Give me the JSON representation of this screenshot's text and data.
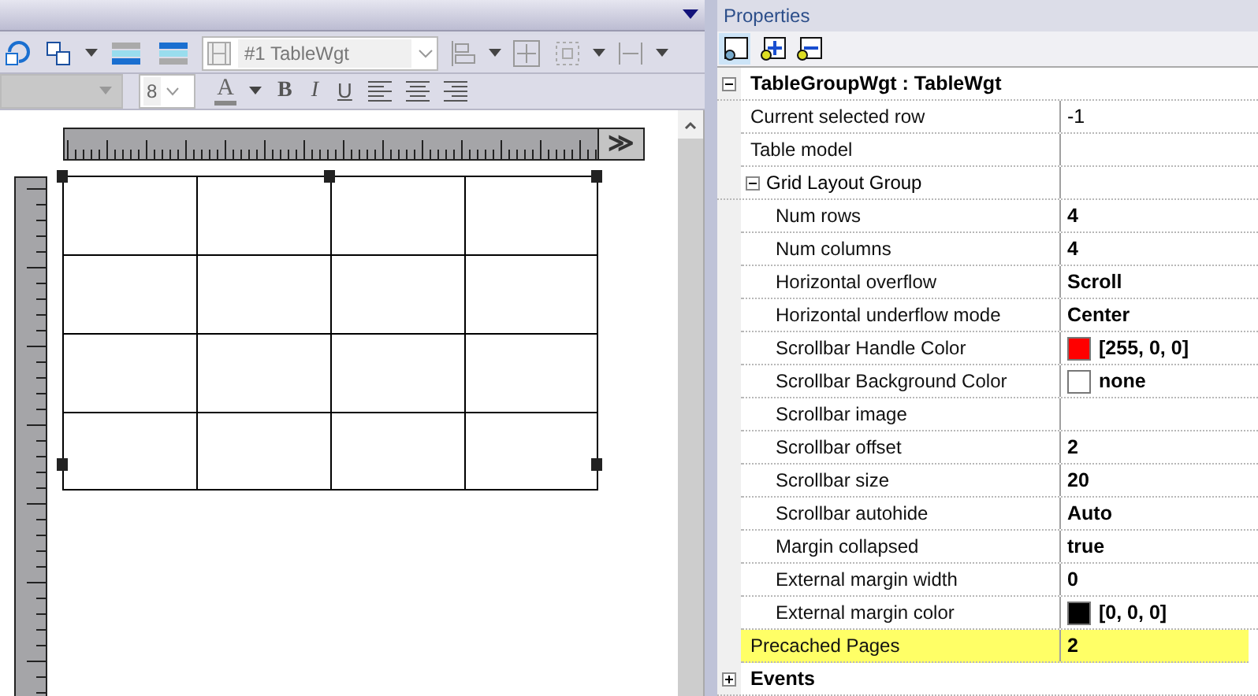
{
  "toolbar": {
    "object_combo": "#1 TableWgt",
    "font_size": "8",
    "text_color_glyph": "A",
    "bold_glyph": "B",
    "italic_glyph": "I",
    "underline_glyph": "U"
  },
  "ruler": {
    "expand_glyph": "≫"
  },
  "panel_title": "Properties",
  "properties": [
    {
      "kind": "group",
      "label": "TableGroupWgt : TableWgt",
      "expanded": true,
      "children": [
        {
          "kind": "property",
          "label": "Current selected row",
          "value": "-1",
          "modified": false,
          "selected": false
        },
        {
          "kind": "property",
          "label": "Table model",
          "selected": false
        },
        {
          "kind": "group",
          "label": "Grid Layout Group",
          "expanded": true,
          "children": [
            {
              "kind": "property",
              "label": "Num rows",
              "value": "4",
              "modified": true,
              "selected": false
            },
            {
              "kind": "property",
              "label": "Num columns",
              "value": "4",
              "modified": true,
              "selected": false
            },
            {
              "kind": "property",
              "label": "Horizontal overflow",
              "value": "Scroll",
              "modified": true,
              "selected": false
            },
            {
              "kind": "property",
              "label": "Horizontal underflow mode",
              "value": "Center",
              "modified": true,
              "selected": false
            },
            {
              "kind": "property",
              "label": "Scrollbar Handle Color",
              "value": "[255, 0, 0]",
              "modified": true,
              "color": "#ff0000",
              "selected": false
            },
            {
              "kind": "property",
              "label": "Scrollbar Background Color",
              "value": "none",
              "modified": true,
              "color": "#ffffff",
              "selected": false
            },
            {
              "kind": "property",
              "label": "Scrollbar image",
              "selected": false
            },
            {
              "kind": "property",
              "label": "Scrollbar offset",
              "value": "2",
              "modified": true,
              "selected": false
            },
            {
              "kind": "property",
              "label": "Scrollbar size",
              "value": "20",
              "modified": true,
              "selected": false
            },
            {
              "kind": "property",
              "label": "Scrollbar autohide",
              "value": "Auto",
              "modified": true,
              "selected": false
            },
            {
              "kind": "property",
              "label": "Margin collapsed",
              "value": "true",
              "modified": true,
              "selected": false
            },
            {
              "kind": "property",
              "label": "External margin width",
              "value": "0",
              "modified": true,
              "selected": false
            },
            {
              "kind": "property",
              "label": "External margin color",
              "value": "[0, 0, 0]",
              "modified": true,
              "color": "#000000",
              "selected": false
            }
          ]
        },
        {
          "kind": "property",
          "label": "Precached Pages",
          "value": "2",
          "modified": true,
          "selected": true
        }
      ]
    },
    {
      "kind": "group",
      "label": "Events",
      "expanded": false
    }
  ]
}
